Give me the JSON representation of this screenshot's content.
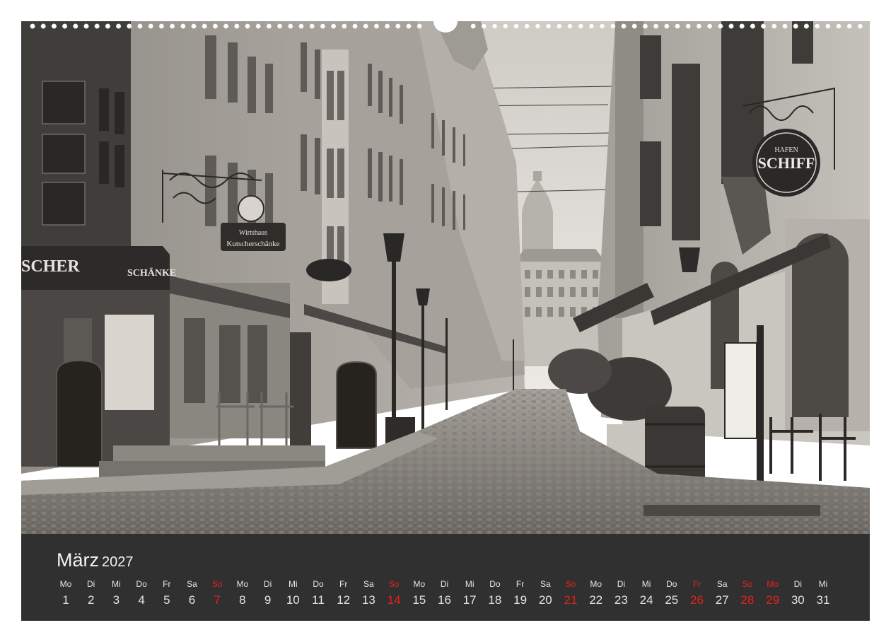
{
  "calendar": {
    "month_name": "März",
    "year": "2027",
    "days": [
      {
        "wd": "Mo",
        "d": "1",
        "red": false
      },
      {
        "wd": "Di",
        "d": "2",
        "red": false
      },
      {
        "wd": "Mi",
        "d": "3",
        "red": false
      },
      {
        "wd": "Do",
        "d": "4",
        "red": false
      },
      {
        "wd": "Fr",
        "d": "5",
        "red": false
      },
      {
        "wd": "Sa",
        "d": "6",
        "red": false
      },
      {
        "wd": "So",
        "d": "7",
        "red": true
      },
      {
        "wd": "Mo",
        "d": "8",
        "red": false
      },
      {
        "wd": "Di",
        "d": "9",
        "red": false
      },
      {
        "wd": "Mi",
        "d": "10",
        "red": false
      },
      {
        "wd": "Do",
        "d": "11",
        "red": false
      },
      {
        "wd": "Fr",
        "d": "12",
        "red": false
      },
      {
        "wd": "Sa",
        "d": "13",
        "red": false
      },
      {
        "wd": "So",
        "d": "14",
        "red": true
      },
      {
        "wd": "Mo",
        "d": "15",
        "red": false
      },
      {
        "wd": "Di",
        "d": "16",
        "red": false
      },
      {
        "wd": "Mi",
        "d": "17",
        "red": false
      },
      {
        "wd": "Do",
        "d": "18",
        "red": false
      },
      {
        "wd": "Fr",
        "d": "19",
        "red": false
      },
      {
        "wd": "Sa",
        "d": "20",
        "red": false
      },
      {
        "wd": "So",
        "d": "21",
        "red": true
      },
      {
        "wd": "Mo",
        "d": "22",
        "red": false
      },
      {
        "wd": "Di",
        "d": "23",
        "red": false
      },
      {
        "wd": "Mi",
        "d": "24",
        "red": false
      },
      {
        "wd": "Do",
        "d": "25",
        "red": false
      },
      {
        "wd": "Fr",
        "d": "26",
        "red": true
      },
      {
        "wd": "Sa",
        "d": "27",
        "red": false
      },
      {
        "wd": "So",
        "d": "28",
        "red": true
      },
      {
        "wd": "Mo",
        "d": "29",
        "red": true
      },
      {
        "wd": "Di",
        "d": "30",
        "red": false
      },
      {
        "wd": "Mi",
        "d": "31",
        "red": false
      }
    ],
    "holiday_color": "#e2231a"
  },
  "photo": {
    "shop_sign_left": "SCHER",
    "shop_sign_right": "SCHÄNKE",
    "hanging_sign_name": "Wirtshaus",
    "hanging_sign_name2": "Kutscherschänke",
    "pub_sign_top": "HAFEN",
    "pub_sign_main": "SCHIFF"
  }
}
